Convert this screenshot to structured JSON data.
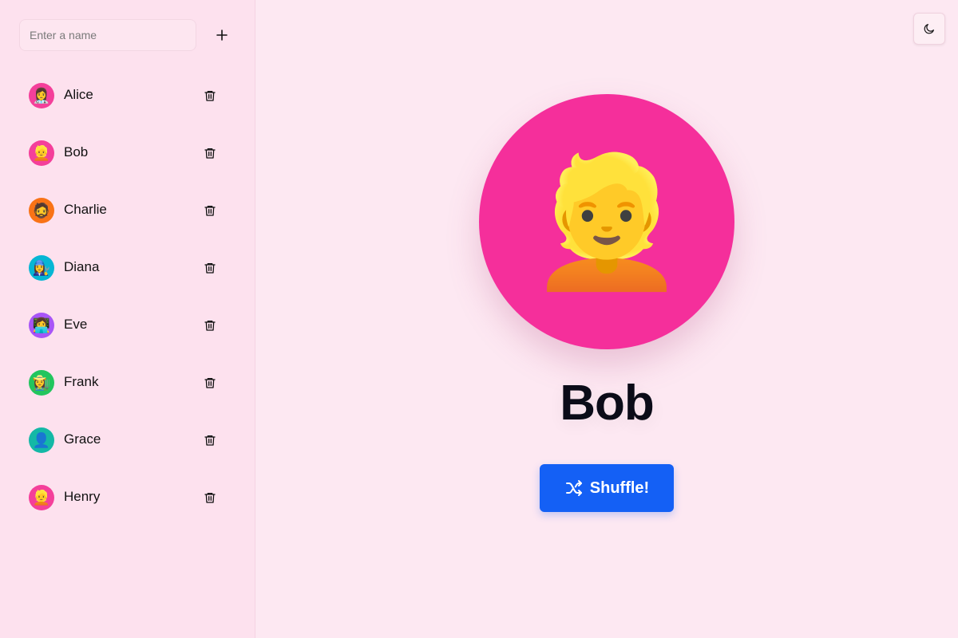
{
  "sidebar": {
    "input": {
      "placeholder": "Enter a name",
      "value": ""
    },
    "add_icon": "plus-icon",
    "people": [
      {
        "name": "Alice",
        "emoji": "👩‍⚕️",
        "color": "#f43f9a"
      },
      {
        "name": "Bob",
        "emoji": "👱",
        "color": "#f43f9a"
      },
      {
        "name": "Charlie",
        "emoji": "🧔",
        "color": "#f97316"
      },
      {
        "name": "Diana",
        "emoji": "👩‍🔧",
        "color": "#06b6d4"
      },
      {
        "name": "Eve",
        "emoji": "👩‍💻",
        "color": "#a855f7"
      },
      {
        "name": "Frank",
        "emoji": "👩‍🌾",
        "color": "#22c55e"
      },
      {
        "name": "Grace",
        "emoji": "👤",
        "color": "#14b8a6"
      },
      {
        "name": "Henry",
        "emoji": "👱",
        "color": "#f43f9a"
      }
    ],
    "delete_icon": "trash-icon"
  },
  "main": {
    "theme_icon": "moon-icon",
    "selected": {
      "name": "Bob",
      "emoji": "👱",
      "color": "#f52f9b"
    },
    "shuffle_label": "Shuffle!",
    "shuffle_icon": "shuffle-icon",
    "accent": "#1460f5"
  }
}
